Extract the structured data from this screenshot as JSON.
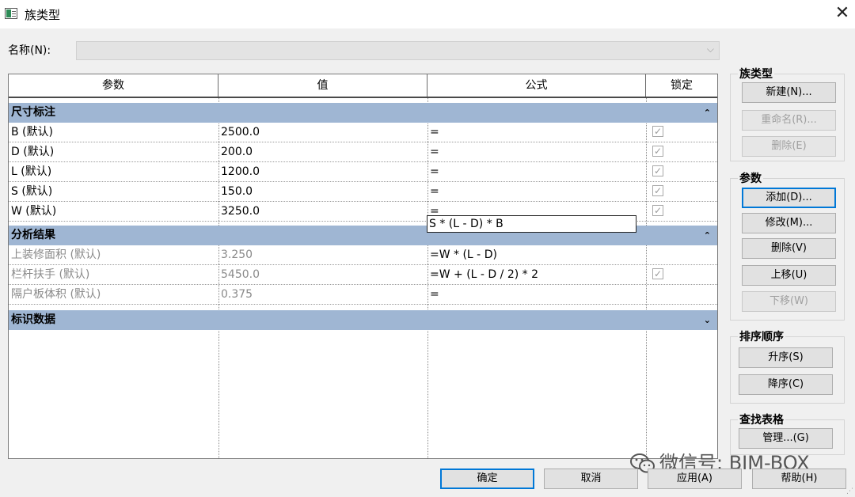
{
  "window": {
    "title": "族类型",
    "close_glyph": "✕"
  },
  "name_field": {
    "label": "名称(N):",
    "value": ""
  },
  "columns": [
    "参数",
    "值",
    "公式",
    "锁定"
  ],
  "groups": [
    {
      "label": "尺寸标注",
      "toggle": "⌃⌃",
      "rows": [
        {
          "param": "B (默认)",
          "value": "2500.0",
          "formula": "=",
          "locked": true
        },
        {
          "param": "D (默认)",
          "value": "200.0",
          "formula": "=",
          "locked": true
        },
        {
          "param": "L (默认)",
          "value": "1200.0",
          "formula": "=",
          "locked": true
        },
        {
          "param": "S (默认)",
          "value": "150.0",
          "formula": "=",
          "locked": true
        },
        {
          "param": "W (默认)",
          "value": "3250.0",
          "formula": "=",
          "locked": true
        }
      ]
    },
    {
      "label": "分析结果",
      "toggle": "⌃⌃",
      "rows": [
        {
          "param": "上装修面积 (默认)",
          "value": "3.250",
          "formula": "=W * (L - D)",
          "locked": false
        },
        {
          "param": "栏杆扶手 (默认)",
          "value": "5450.0",
          "formula": "=W + (L - D / 2) * 2",
          "locked": true
        },
        {
          "param": "隔户板体积 (默认)",
          "value": "0.375",
          "formula": "=",
          "formula_edit": "S * (L - D) * B",
          "locked": false
        }
      ]
    },
    {
      "label": "标识数据",
      "toggle": "⌄⌄",
      "rows": []
    }
  ],
  "right_panel": {
    "family_types": {
      "label": "族类型",
      "new": "新建(N)...",
      "rename": "重命名(R)...",
      "delete": "删除(E)"
    },
    "parameters": {
      "label": "参数",
      "add": "添加(D)...",
      "modify": "修改(M)...",
      "delete": "删除(V)",
      "move_up": "上移(U)",
      "move_down": "下移(W)"
    },
    "sort_order": {
      "label": "排序顺序",
      "ascending": "升序(S)",
      "descending": "降序(C)"
    },
    "lookup_tables": {
      "label": "查找表格",
      "manage": "管理...(G)"
    }
  },
  "footer": {
    "ok": "确定",
    "cancel": "取消",
    "apply": "应用(A)",
    "help": "帮助(H)"
  },
  "watermark": {
    "text": "微信号: BIM-BOX"
  },
  "colors": {
    "group_header": "#9fb6d3",
    "focus": "#0078d7"
  }
}
